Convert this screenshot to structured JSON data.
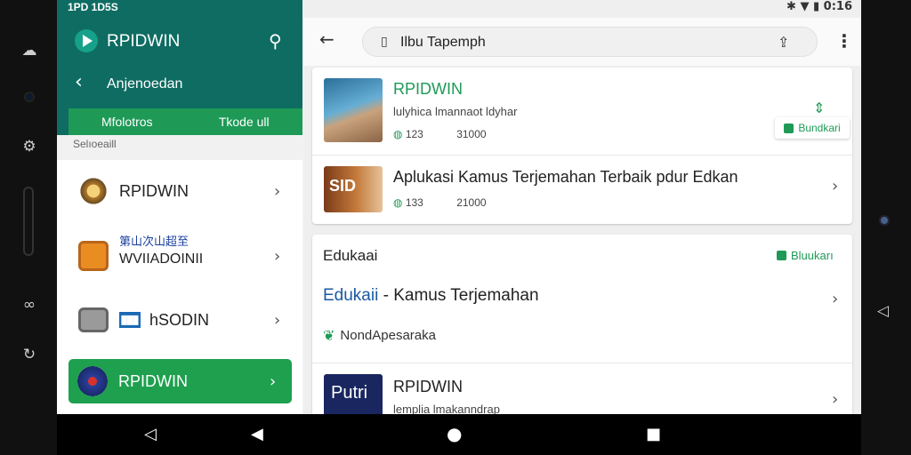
{
  "status_bar": {
    "left_text": "1PD 1D5S",
    "time": "0:16",
    "icons": [
      "bluetooth-icon",
      "wifi-icon",
      "battery-icon"
    ]
  },
  "left_panel": {
    "app_title": "RPIDWIN",
    "subtitle": "Anjenoedan",
    "tabs": [
      {
        "label": "Mfolotros"
      },
      {
        "label": "Tkode ull"
      }
    ],
    "section_label": "Selıoeaill",
    "items": [
      {
        "name": "RPIDWIN",
        "icon": "badge-icon"
      },
      {
        "name": "WVIIADOINII",
        "prefix": "第山次山超至",
        "icon": "robot-icon"
      },
      {
        "name": "hSODIN",
        "prefix_badge": "███",
        "icon": "printer-icon"
      },
      {
        "name": "RPIDWIN",
        "icon": "globe-icon",
        "active": true
      }
    ]
  },
  "right_panel": {
    "url": "Ilbu Tapemph",
    "card1": {
      "apps": [
        {
          "title": "RPIDWIN",
          "meta": "lulyhica lmannaot ldyhar",
          "stat1": "123",
          "stat2": "31000",
          "button": "Bundkari"
        },
        {
          "title": "Aplukasi Kamus Terjemahan Terbaik pdur Edkan",
          "thumb_label": "SID",
          "stat1": "133",
          "stat2": "21000"
        }
      ]
    },
    "card2": {
      "section_title": "Edukaai",
      "button": "Bluukarı",
      "link_prefix": "Edukaii",
      "link_rest": " - Kamus Terjemahan",
      "tag": "NondApesaraka",
      "app": {
        "title": "RPIDWIN",
        "thumb_label": "Putri",
        "meta": "lemplia lmakanndrap"
      }
    }
  },
  "colors": {
    "header_green": "#0e6c62",
    "accent_green": "#1e9a56"
  }
}
